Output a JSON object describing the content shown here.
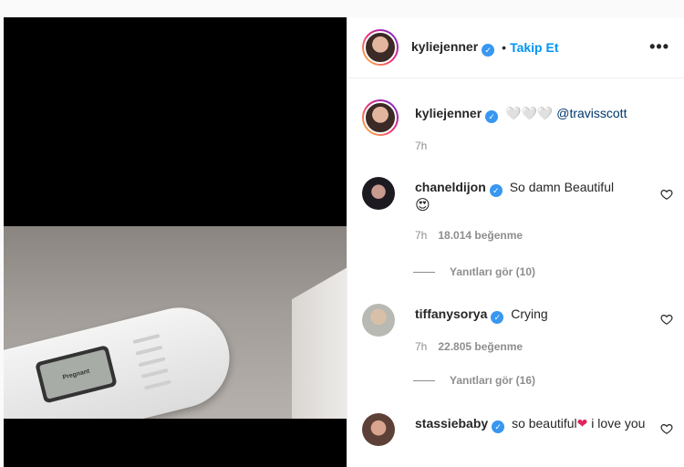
{
  "post": {
    "author": "kyliejenner",
    "follow_label": "Takip Et",
    "dot": "•",
    "more_label": "•••",
    "caption_emoji": "🤍🤍🤍",
    "caption_mention": "@travisscott",
    "caption_time": "7h",
    "test_window_text": "Pregnant"
  },
  "comments": [
    {
      "user": "chaneldijon",
      "text": "So damn Beautiful",
      "emoji": "😍",
      "time": "7h",
      "likes": "18.014 beğenme",
      "replies": "Yanıtları gör (10)"
    },
    {
      "user": "tiffanysorya",
      "text": "Crying",
      "time": "7h",
      "likes": "22.805 beğenme",
      "replies": "Yanıtları gör (16)"
    },
    {
      "user": "stassiebaby",
      "text_before": "so beautiful",
      "emoji": "❤",
      "text_after": "i love you"
    }
  ],
  "colors": {
    "accent": "#0095f6",
    "verified": "#3897f0",
    "muted": "#8e8e8e"
  },
  "icons": {
    "verified": "verified-badge-icon",
    "heart": "heart-icon",
    "more": "more-options-icon"
  }
}
